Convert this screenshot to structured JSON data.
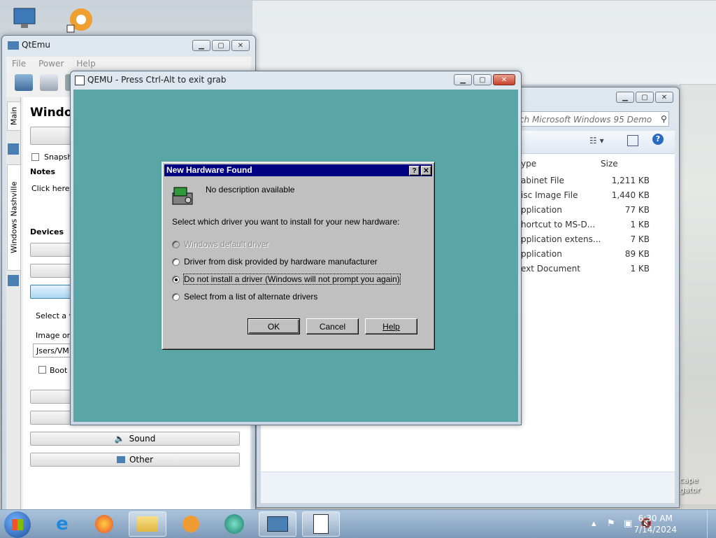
{
  "qtemu": {
    "title": "QtEmu",
    "menu": [
      "File",
      "Power",
      "Help"
    ],
    "tabs": [
      "Main",
      "Windows Nashville"
    ],
    "heading": "Windov",
    "snapshot_label": "Snapsho",
    "notes_label": "Notes",
    "notes_placeholder": "Click here t",
    "devices_label": "Devices",
    "select_label": "Select a va",
    "image_label": "Image or c",
    "path_value": "Jsers/VM1",
    "boot_label": "Boot f",
    "sound_label": "Sound",
    "other_label": "Other"
  },
  "qemu": {
    "title": "QEMU - Press Ctrl-Alt to exit grab"
  },
  "dialog": {
    "title": "New Hardware Found",
    "help_q": "?",
    "close_x": "✕",
    "description": "No description available",
    "prompt": "Select which driver you want to install for your new hardware:",
    "options": [
      {
        "label": "Windows default driver",
        "enabled": false,
        "selected": false
      },
      {
        "label": "Driver from disk provided by hardware manufacturer",
        "enabled": true,
        "selected": false
      },
      {
        "label": "Do not install a driver (Windows will not prompt you again)",
        "enabled": true,
        "selected": true
      },
      {
        "label": "Select from a list of alternate drivers",
        "enabled": true,
        "selected": false
      }
    ],
    "ok": "OK",
    "cancel": "Cancel",
    "help": "Help"
  },
  "explorer": {
    "search_placeholder": "rch Microsoft Windows 95 Demo",
    "columns": {
      "type": "ype",
      "size": "Size"
    },
    "rows": [
      {
        "type": "abinet File",
        "size": "1,211 KB"
      },
      {
        "type": "isc Image File",
        "size": "1,440 KB"
      },
      {
        "type": "pplication",
        "size": "77 KB"
      },
      {
        "type": "hortcut to MS-D...",
        "size": "1 KB"
      },
      {
        "type": "pplication extens...",
        "size": "7 KB"
      },
      {
        "type": "pplication",
        "size": "89 KB"
      },
      {
        "type": "ext Document",
        "size": "1 KB"
      }
    ]
  },
  "desktop": {
    "icon_label_1": "cape",
    "icon_label_2": "gator"
  },
  "taskbar": {
    "time": "6:30 AM",
    "date": "7/14/2024"
  }
}
